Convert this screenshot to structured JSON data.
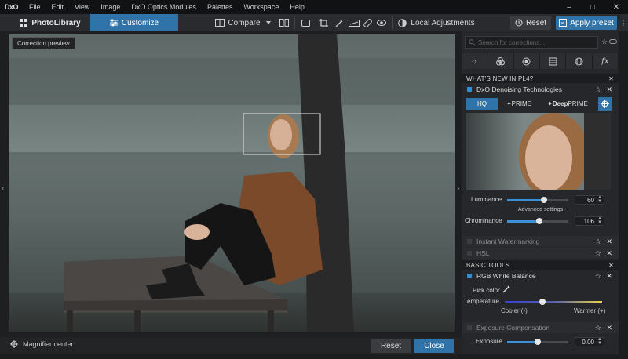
{
  "app": {
    "logo": "DxO",
    "menu": [
      "File",
      "Edit",
      "View",
      "Image",
      "DxO Optics Modules",
      "Palettes",
      "Workspace",
      "Help"
    ],
    "window_controls": [
      "–",
      "□",
      "✕"
    ]
  },
  "toolbar": {
    "tab_photolibrary": "PhotoLibrary",
    "tab_customize": "Customize",
    "compare_label": "Compare",
    "local_adjustments_label": "Local Adjustments",
    "reset_label": "Reset",
    "apply_preset_label": "Apply preset"
  },
  "viewer": {
    "correction_preview_label": "Correction preview",
    "magnifier_label": "Magnifier center",
    "reset_label": "Reset",
    "close_label": "Close"
  },
  "panel": {
    "search_placeholder": "Search for corrections...",
    "whats_new_header": "WHAT'S NEW IN PL4?",
    "denoising_title": "DxO Denoising Technologies",
    "modes": [
      "HQ",
      "PRIME",
      "DeepPRIME"
    ],
    "mode_prefix_deep": "Deep",
    "mode_deep_rest": "PRIME",
    "active_mode": "HQ",
    "luminance_label": "Luminance",
    "luminance_value": "60",
    "luminance_level": 0.6,
    "advanced_settings": "- Advanced settings -",
    "chrominance_label": "Chrominance",
    "chrominance_value": "106",
    "chrominance_level": 0.53,
    "instant_watermarking": "Instant Watermarking",
    "hsl": "HSL",
    "basic_tools_header": "BASIC TOOLS",
    "rgb_white_balance": "RGB White Balance",
    "pick_color": "Pick color",
    "temperature_label": "Temperature",
    "temperature_level": 0.39,
    "cooler_label": "Cooler (-)",
    "warmer_label": "Warmer (+)",
    "exposure_comp": "Exposure Compensation",
    "exposure_label": "Exposure",
    "exposure_value": "0.00",
    "exposure_level": 0.5
  },
  "colors": {
    "accent": "#2f73a8",
    "slider_fill": "#3d8fd6"
  }
}
